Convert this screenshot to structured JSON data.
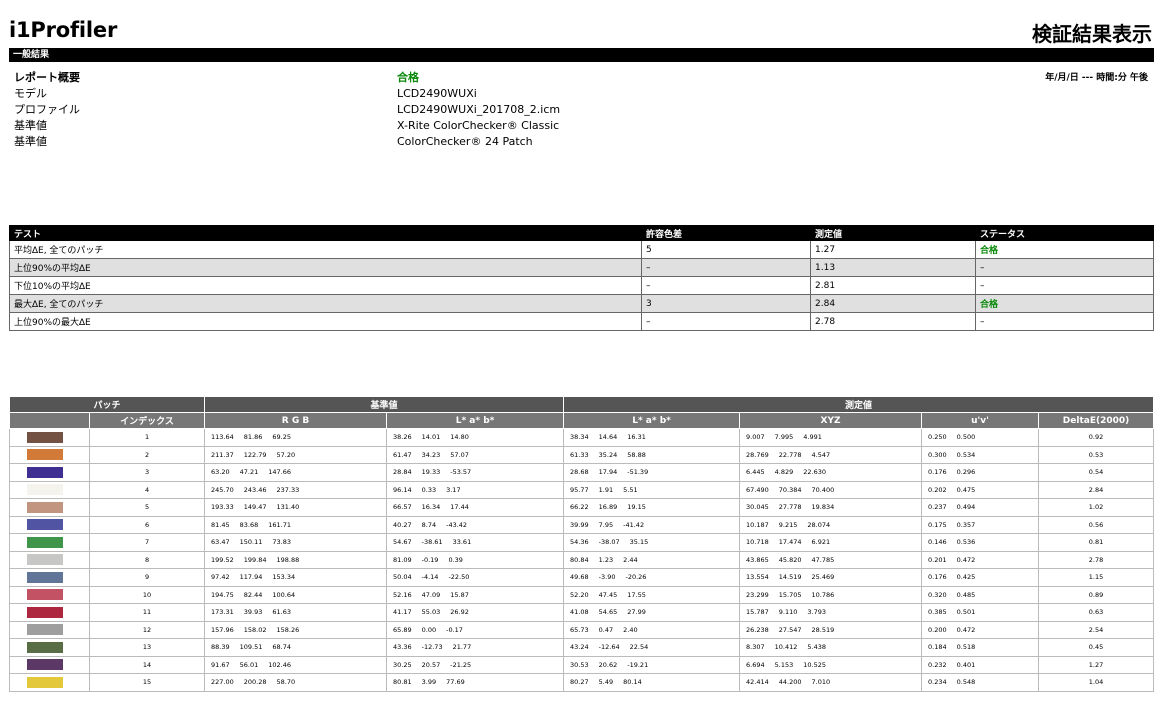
{
  "header": {
    "brand": "i1Profiler",
    "title": "検証結果表示"
  },
  "general": {
    "section_label": "一般結果",
    "rows": [
      {
        "label": "レポート概要",
        "value": "合格"
      },
      {
        "label": "モデル",
        "value": "LCD2490WUXi"
      },
      {
        "label": "プロファイル",
        "value": "LCD2490WUXi_201708_2.icm"
      },
      {
        "label": "基準値",
        "value": "X-Rite ColorChecker® Classic"
      },
      {
        "label": "基準値",
        "value": "ColorChecker® 24 Patch"
      }
    ],
    "date_label": "年/月/日 --- 時間:分 午後"
  },
  "tests": {
    "headers": [
      "テスト",
      "許容色差",
      "測定値",
      "ステータス"
    ],
    "rows": [
      {
        "name": "平均∆E, 全てのパッチ",
        "tol": "5",
        "meas": "1.27",
        "status": "合格"
      },
      {
        "name": "上位90%の平均∆E",
        "tol": "–",
        "meas": "1.13",
        "status": "–"
      },
      {
        "name": "下位10%の平均∆E",
        "tol": "–",
        "meas": "2.81",
        "status": "–"
      },
      {
        "name": "最大∆E, 全てのパッチ",
        "tol": "3",
        "meas": "2.84",
        "status": "合格"
      },
      {
        "name": "上位90%の最大∆E",
        "tol": "–",
        "meas": "2.78",
        "status": "–"
      }
    ]
  },
  "patches": {
    "group_headers": {
      "patch": "パッチ",
      "reference": "基準値",
      "measured": "測定値"
    },
    "sub_headers": {
      "index": "インデックス",
      "rgb": "R G B",
      "lab_ref": "L* a* b*",
      "lab_meas": "L* a* b*",
      "xyz": "XYZ",
      "uv": "u'v'",
      "de": "DeltaE(2000)"
    },
    "rows": [
      {
        "color": "#735244",
        "index": "1",
        "rgb": [
          "113.64",
          "81.86",
          "69.25"
        ],
        "lab_ref": [
          "38.26",
          "14.01",
          "14.80"
        ],
        "lab_meas": [
          "38.34",
          "14.64",
          "16.31"
        ],
        "xyz": [
          "9.007",
          "7.995",
          "4.991"
        ],
        "uv": [
          "0.250",
          "0.500"
        ],
        "de": "0.92"
      },
      {
        "color": "#d27b39",
        "index": "2",
        "rgb": [
          "211.37",
          "122.79",
          "57.20"
        ],
        "lab_ref": [
          "61.47",
          "34.23",
          "57.07"
        ],
        "lab_meas": [
          "61.33",
          "35.24",
          "58.88"
        ],
        "xyz": [
          "28.769",
          "22.778",
          "4.547"
        ],
        "uv": [
          "0.300",
          "0.534"
        ],
        "de": "0.53"
      },
      {
        "color": "#3f2f93",
        "index": "3",
        "rgb": [
          "63.20",
          "47.21",
          "147.66"
        ],
        "lab_ref": [
          "28.84",
          "19.33",
          "-53.57"
        ],
        "lab_meas": [
          "28.68",
          "17.94",
          "-51.39"
        ],
        "xyz": [
          "6.445",
          "4.829",
          "22.630"
        ],
        "uv": [
          "0.176",
          "0.296"
        ],
        "de": "0.54"
      },
      {
        "color": "#f5f3ed",
        "index": "4",
        "rgb": [
          "245.70",
          "243.46",
          "237.33"
        ],
        "lab_ref": [
          "96.14",
          "0.33",
          "3.17"
        ],
        "lab_meas": [
          "95.77",
          "1.91",
          "5.51"
        ],
        "xyz": [
          "67.490",
          "70.384",
          "70.400"
        ],
        "uv": [
          "0.202",
          "0.475"
        ],
        "de": "2.84"
      },
      {
        "color": "#c1957f",
        "index": "5",
        "rgb": [
          "193.33",
          "149.47",
          "131.40"
        ],
        "lab_ref": [
          "66.57",
          "16.34",
          "17.44"
        ],
        "lab_meas": [
          "66.22",
          "16.89",
          "19.15"
        ],
        "xyz": [
          "30.045",
          "27.778",
          "19.834"
        ],
        "uv": [
          "0.237",
          "0.494"
        ],
        "de": "1.02"
      },
      {
        "color": "#5154a2",
        "index": "6",
        "rgb": [
          "81.45",
          "83.68",
          "161.71"
        ],
        "lab_ref": [
          "40.27",
          "8.74",
          "-43.42"
        ],
        "lab_meas": [
          "39.99",
          "7.95",
          "-41.42"
        ],
        "xyz": [
          "10.187",
          "9.215",
          "28.074"
        ],
        "uv": [
          "0.175",
          "0.357"
        ],
        "de": "0.56"
      },
      {
        "color": "#3f964a",
        "index": "7",
        "rgb": [
          "63.47",
          "150.11",
          "73.83"
        ],
        "lab_ref": [
          "54.67",
          "-38.61",
          "33.61"
        ],
        "lab_meas": [
          "54.36",
          "-38.07",
          "35.15"
        ],
        "xyz": [
          "10.718",
          "17.474",
          "6.921"
        ],
        "uv": [
          "0.146",
          "0.536"
        ],
        "de": "0.81"
      },
      {
        "color": "#c7c7c6",
        "index": "8",
        "rgb": [
          "199.52",
          "199.84",
          "198.88"
        ],
        "lab_ref": [
          "81.09",
          "-0.19",
          "0.39"
        ],
        "lab_meas": [
          "80.84",
          "1.23",
          "2.44"
        ],
        "xyz": [
          "43.865",
          "45.820",
          "47.785"
        ],
        "uv": [
          "0.201",
          "0.472"
        ],
        "de": "2.78"
      },
      {
        "color": "#617599",
        "index": "9",
        "rgb": [
          "97.42",
          "117.94",
          "153.34"
        ],
        "lab_ref": [
          "50.04",
          "-4.14",
          "-22.50"
        ],
        "lab_meas": [
          "49.68",
          "-3.90",
          "-20.26"
        ],
        "xyz": [
          "13.554",
          "14.519",
          "25.469"
        ],
        "uv": [
          "0.176",
          "0.425"
        ],
        "de": "1.15"
      },
      {
        "color": "#c25264",
        "index": "10",
        "rgb": [
          "194.75",
          "82.44",
          "100.64"
        ],
        "lab_ref": [
          "52.16",
          "47.09",
          "15.87"
        ],
        "lab_meas": [
          "52.20",
          "47.45",
          "17.55"
        ],
        "xyz": [
          "23.299",
          "15.705",
          "10.786"
        ],
        "uv": [
          "0.320",
          "0.485"
        ],
        "de": "0.89"
      },
      {
        "color": "#ad283e",
        "index": "11",
        "rgb": [
          "173.31",
          "39.93",
          "61.63"
        ],
        "lab_ref": [
          "41.17",
          "55.03",
          "26.92"
        ],
        "lab_meas": [
          "41.08",
          "54.65",
          "27.99"
        ],
        "xyz": [
          "15.787",
          "9.110",
          "3.793"
        ],
        "uv": [
          "0.385",
          "0.501"
        ],
        "de": "0.63"
      },
      {
        "color": "#9e9e9e",
        "index": "12",
        "rgb": [
          "157.96",
          "158.02",
          "158.26"
        ],
        "lab_ref": [
          "65.89",
          "0.00",
          "-0.17"
        ],
        "lab_meas": [
          "65.73",
          "0.47",
          "2.40"
        ],
        "xyz": [
          "26.238",
          "27.547",
          "28.519"
        ],
        "uv": [
          "0.200",
          "0.472"
        ],
        "de": "2.54"
      },
      {
        "color": "#586d45",
        "index": "13",
        "rgb": [
          "88.39",
          "109.51",
          "68.74"
        ],
        "lab_ref": [
          "43.36",
          "-12.73",
          "21.77"
        ],
        "lab_meas": [
          "43.24",
          "-12.64",
          "22.54"
        ],
        "xyz": [
          "8.307",
          "10.412",
          "5.438"
        ],
        "uv": [
          "0.184",
          "0.518"
        ],
        "de": "0.45"
      },
      {
        "color": "#5c3866",
        "index": "14",
        "rgb": [
          "91.67",
          "56.01",
          "102.46"
        ],
        "lab_ref": [
          "30.25",
          "20.57",
          "-21.25"
        ],
        "lab_meas": [
          "30.53",
          "20.62",
          "-19.21"
        ],
        "xyz": [
          "6.694",
          "5.153",
          "10.525"
        ],
        "uv": [
          "0.232",
          "0.401"
        ],
        "de": "1.27"
      },
      {
        "color": "#e3c83b",
        "index": "15",
        "rgb": [
          "227.00",
          "200.28",
          "58.70"
        ],
        "lab_ref": [
          "80.81",
          "3.99",
          "77.69"
        ],
        "lab_meas": [
          "80.27",
          "5.49",
          "80.14"
        ],
        "xyz": [
          "42.414",
          "44.200",
          "7.010"
        ],
        "uv": [
          "0.234",
          "0.548"
        ],
        "de": "1.04"
      }
    ]
  }
}
